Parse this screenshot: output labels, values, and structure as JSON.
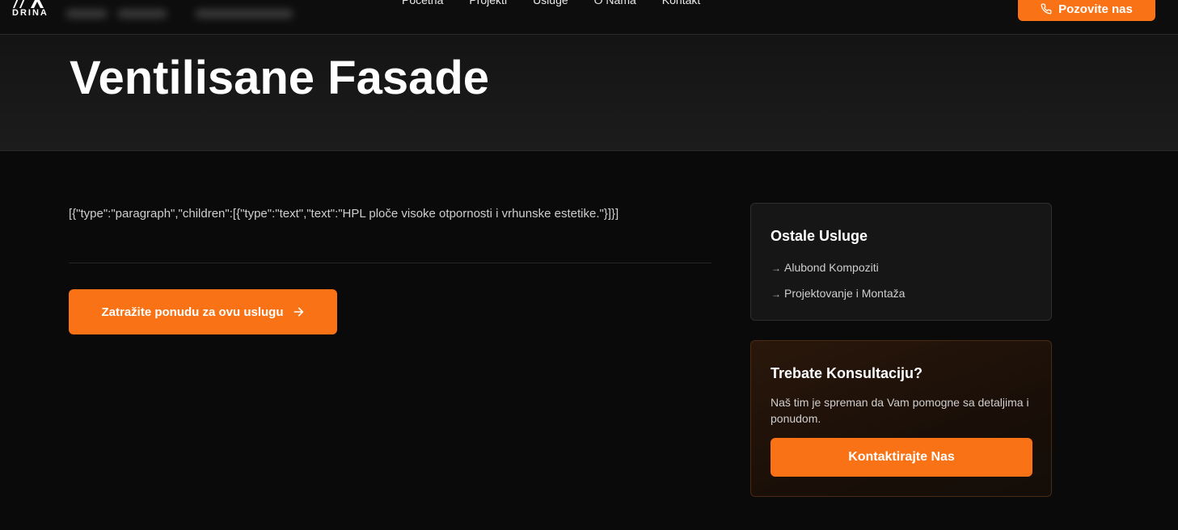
{
  "header": {
    "logo_text": "DRINA",
    "nav": [
      "Početna",
      "Projekti",
      "Usluge",
      "O Nama",
      "Kontakt"
    ],
    "call_button": "Pozovite nas"
  },
  "hero": {
    "title": "Ventilisane Fasade"
  },
  "main": {
    "raw_content": "[{\"type\":\"paragraph\",\"children\":[{\"type\":\"text\",\"text\":\"HPL ploče visoke otpornosti i vrhunske estetike.\"}]}]",
    "cta_button": "Zatražite ponudu za ovu uslugu"
  },
  "sidebar": {
    "services_title": "Ostale Usluge",
    "services": [
      "Alubond Kompoziti",
      "Projektovanje i Montaža"
    ],
    "consult_title": "Trebate Konsultaciju?",
    "consult_text": "Naš tim je spreman da Vam pomogne sa detaljima i ponudom.",
    "consult_button": "Kontaktirajte Nas"
  },
  "colors": {
    "accent": "#f97316",
    "background": "#0a0a0a",
    "card": "#161616"
  }
}
